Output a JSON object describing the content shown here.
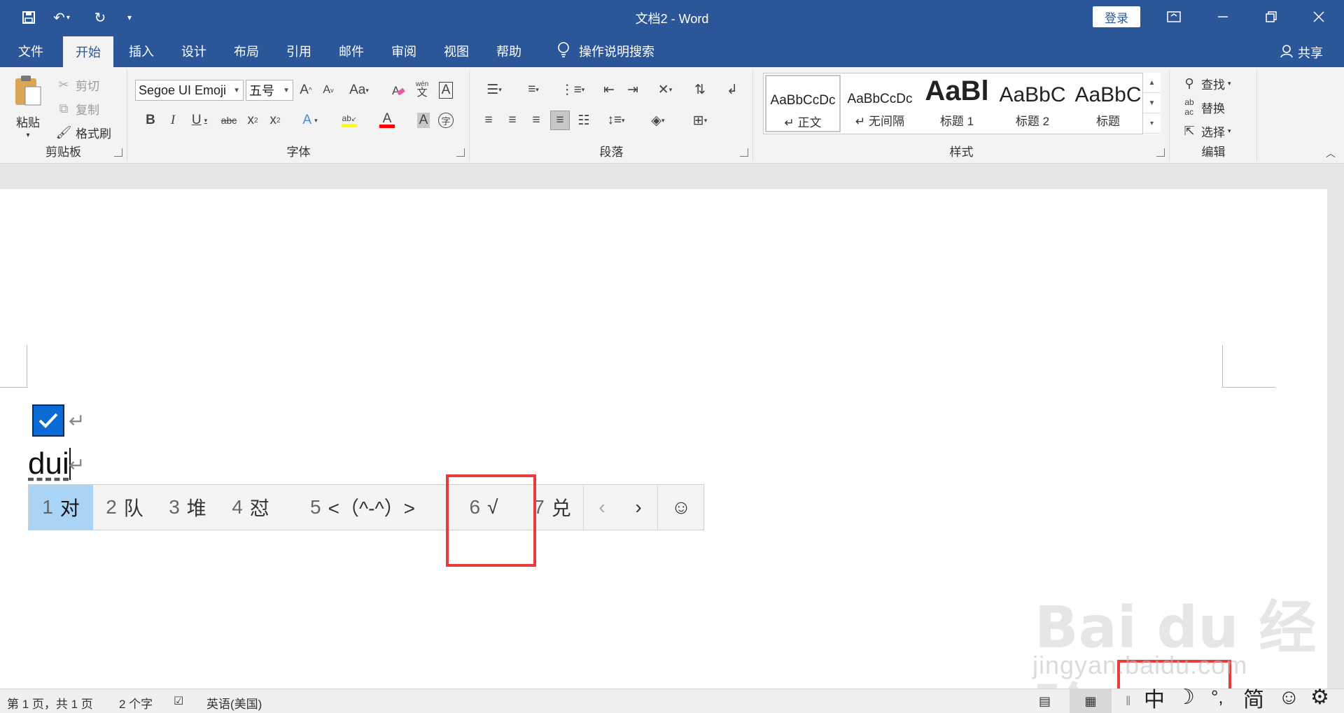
{
  "window": {
    "title": "文档2  -  Word",
    "login_label": "登录",
    "controls": [
      "ribbon-display-icon",
      "minimize-icon",
      "restore-icon",
      "close-icon"
    ]
  },
  "quick_access": [
    "save-icon",
    "undo-icon",
    "redo-icon",
    "customize-icon"
  ],
  "tabs": [
    "文件",
    "开始",
    "插入",
    "设计",
    "布局",
    "引用",
    "邮件",
    "审阅",
    "视图",
    "帮助"
  ],
  "active_tab": "开始",
  "tell_me": "操作说明搜索",
  "share_label": "共享",
  "clipboard": {
    "label": "剪贴板",
    "paste": "粘贴",
    "cut": "剪切",
    "copy": "复制",
    "format_painter": "格式刷"
  },
  "font": {
    "label": "字体",
    "font_name": "Segoe UI Emoji",
    "font_size": "五号"
  },
  "paragraph": {
    "label": "段落"
  },
  "styles": {
    "label": "样式",
    "items": [
      {
        "sample": "AaBbCcDc",
        "name": "↵ 正文"
      },
      {
        "sample": "AaBbCcDc",
        "name": "↵ 无间隔"
      },
      {
        "sample": "AaBl",
        "name": "标题 1"
      },
      {
        "sample": "AaBbC",
        "name": "标题 2"
      },
      {
        "sample": "AaBbC",
        "name": "标题"
      }
    ]
  },
  "editing": {
    "label": "编辑",
    "find": "查找",
    "replace": "替换",
    "select": "选择"
  },
  "document": {
    "typed_text": "dui",
    "para_mark": "↵"
  },
  "ime_candidates": [
    {
      "num": "1",
      "text": "对"
    },
    {
      "num": "2",
      "text": "队"
    },
    {
      "num": "3",
      "text": "堆"
    },
    {
      "num": "4",
      "text": "怼"
    },
    {
      "num": "5",
      "text": "<（^-^）>"
    },
    {
      "num": "6",
      "text": "√"
    },
    {
      "num": "7",
      "text": "兑"
    }
  ],
  "ime_nav": {
    "prev": "‹",
    "next": "›",
    "emoji": "☺"
  },
  "watermark": {
    "logo": "Bai du 经验",
    "url": "jingyan.baidu.com"
  },
  "status": {
    "page": "第 1 页，共 1 页",
    "words": "2 个字",
    "language": "英语(美国)"
  },
  "ime_toolbar": {
    "mode": "中",
    "moon": "☽",
    "punct": "°,",
    "simplified": "简",
    "emoji": "☺",
    "settings": "⚙"
  },
  "colors": {
    "title_blue": "#2b579a",
    "highlight_yellow": "#ffff00",
    "font_red": "#ff0000",
    "annotation_red": "#ea3b3b",
    "candidate_selected": "#aad4f5",
    "checkbox_blue": "#0b6bd6"
  }
}
